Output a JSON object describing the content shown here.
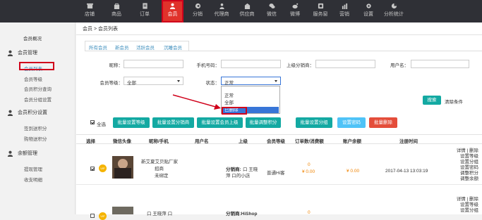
{
  "nav": {
    "items": [
      {
        "label": "店铺",
        "icon": "store-icon"
      },
      {
        "label": "商品",
        "icon": "bag-icon"
      },
      {
        "label": "订单",
        "icon": "order-icon"
      },
      {
        "label": "会员",
        "icon": "user-icon",
        "active": true
      },
      {
        "label": "分销",
        "icon": "share-icon"
      },
      {
        "label": "代理商",
        "icon": "agent-icon"
      },
      {
        "label": "供应商",
        "icon": "supplier-icon"
      },
      {
        "label": "微信",
        "icon": "wechat-icon"
      },
      {
        "label": "微博",
        "icon": "weibo-icon"
      },
      {
        "label": "服务窗",
        "icon": "service-icon"
      },
      {
        "label": "营销",
        "icon": "marketing-icon"
      },
      {
        "label": "设置",
        "icon": "gear-icon"
      },
      {
        "label": "分析统计",
        "icon": "analytics-icon"
      }
    ]
  },
  "sidebar": {
    "overview": "会员概况",
    "groups": [
      {
        "label": "会员管理",
        "items": [
          "会员列表",
          "会员等级",
          "会员积分查询",
          "会员分组设置"
        ]
      },
      {
        "label": "会员积分设置",
        "items": [
          "签到送积分",
          "购物送积分"
        ]
      },
      {
        "label": "余额管理",
        "items": [
          "提现管理",
          "收支明细"
        ]
      }
    ],
    "active_item": "会员列表"
  },
  "breadcrumb": {
    "root": "会员",
    "sep": ">",
    "current": "会员列表"
  },
  "tabs": [
    "所有会员",
    "新会员",
    "活跃会员",
    "沉睡会员"
  ],
  "filters": {
    "nickname_label": "昵称：",
    "phone_label": "手机号码：",
    "upline_label": "上级分销商：",
    "username_label": "用户名：",
    "level_label": "会员等级：",
    "level_value": "全部",
    "status_label": "状态：",
    "status_value": "正常",
    "status_options": [
      "正常",
      "全部",
      "已删除"
    ],
    "status_highlighted": "已删除"
  },
  "search_button": "搜索",
  "clear_link": "清除条件",
  "select_all_label": "全选",
  "actions": [
    {
      "label": "批量设置等级",
      "color": "teal"
    },
    {
      "label": "批量设置分销商",
      "color": "teal"
    },
    {
      "label": "批量设置会员上级",
      "color": "teal"
    },
    {
      "label": "批量调整积分",
      "color": "teal"
    },
    {
      "label": "批量设置分组",
      "color": "teal"
    },
    {
      "label": "设置密码",
      "color": "blue"
    },
    {
      "label": "批量删除",
      "color": "red"
    }
  ],
  "table": {
    "headers": [
      "选择",
      "微信头像",
      "昵称/手机",
      "用户名",
      "上级",
      "会员等级",
      "订单数/消费额",
      "账户余额",
      "注册时间"
    ],
    "rows": [
      {
        "checked": true,
        "badge": "VIP",
        "nickname_line1": "新艾夏艾贝贴厂家",
        "nickname_line2": "招商",
        "phone": "未绑定",
        "username": "",
        "upline_label": "分销商:",
        "upline_line1": "口 王晓",
        "upline_line2": "萍 口的小店",
        "level": "普通Hi客",
        "orders": "0",
        "spent": "¥ 0.00",
        "balance": "¥ 0.00",
        "registered": "2017-04-13 13:03:19",
        "ops": [
          "详情 | 删除",
          "设置等级",
          "设置分组",
          "设置密码",
          "调整积分",
          "调整余额"
        ]
      },
      {
        "checked": false,
        "badge": "VIP",
        "nickname_line1": "口 王晓萍 口",
        "upline_label": "分销商:HiShop",
        "orders": "0",
        "ops": [
          "详情 | 删除",
          "设置等级",
          "设置分组"
        ]
      }
    ]
  },
  "colors": {
    "accent_red": "#e0322b",
    "teal": "#13a9a2",
    "link_blue": "#3c8dbc",
    "nav_bg": "#2f3036"
  }
}
